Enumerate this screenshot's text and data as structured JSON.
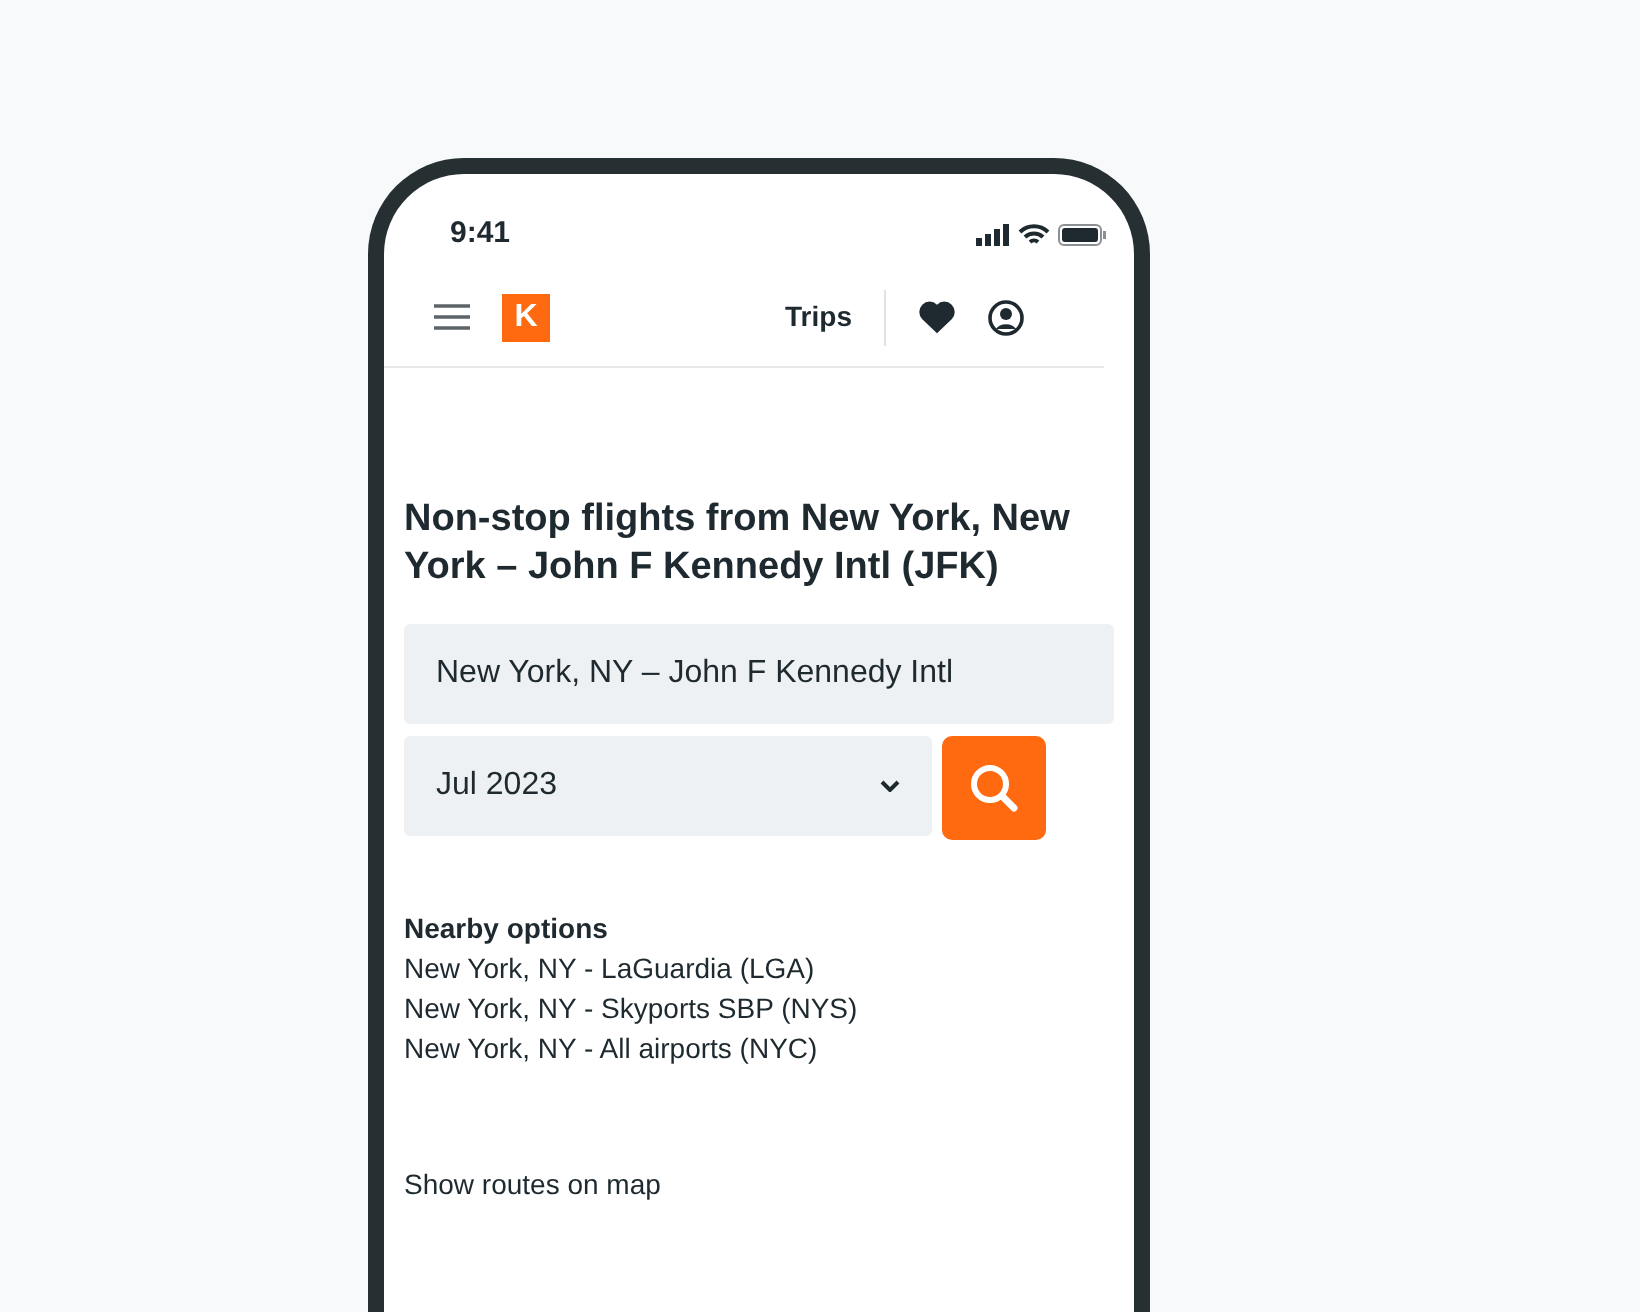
{
  "status_bar": {
    "time": "9:41"
  },
  "header": {
    "logo": "K",
    "trips": "Trips"
  },
  "title": "Non-stop flights from New York, New York – John F Kennedy Intl (JFK)",
  "origin_field": {
    "value": "New York, NY – John F Kennedy Intl"
  },
  "date_select": {
    "value": "Jul 2023"
  },
  "nearby": {
    "heading": "Nearby options",
    "items": [
      "New York, NY - LaGuardia (LGA)",
      "New York, NY - Skyports SBP (NYS)",
      "New York, NY - All airports (NYC)"
    ]
  },
  "map_link": "Show routes on map"
}
